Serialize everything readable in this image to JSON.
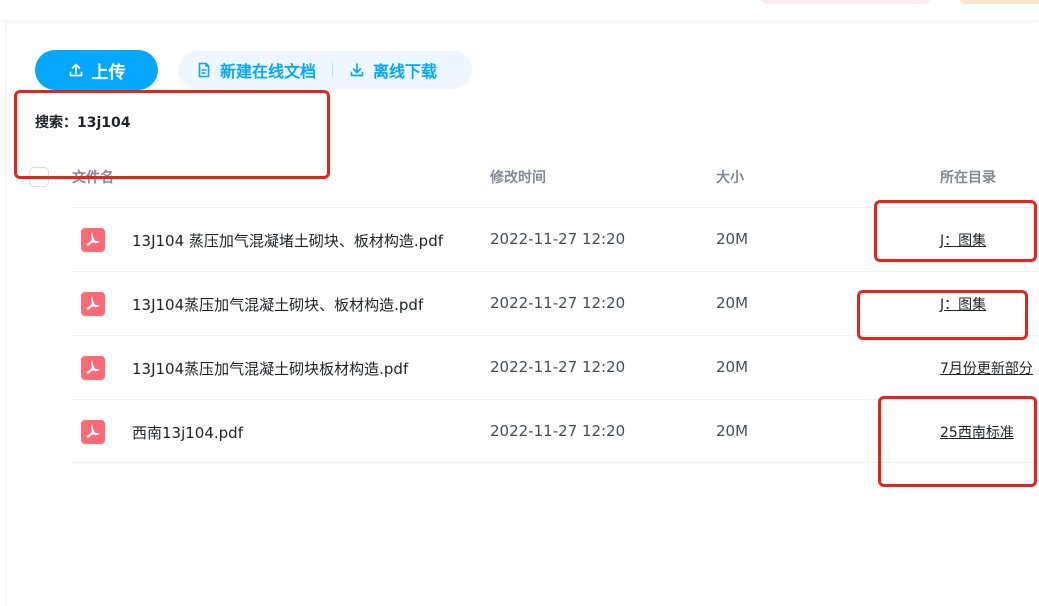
{
  "toolbar": {
    "upload_label": "上传",
    "new_doc_label": "新建在线文档",
    "offline_download_label": "离线下载"
  },
  "search": {
    "label": "搜索：13j104"
  },
  "table": {
    "columns": {
      "name": "文件名",
      "modified": "修改时间",
      "size": "大小",
      "directory": "所在目录"
    },
    "rows": [
      {
        "name": "13J104 蒸压加气混凝堵土砌块、板材构造.pdf",
        "modified": "2022-11-27 12:20",
        "size": "20M",
        "directory": "J：图集",
        "icon": "pdf-icon"
      },
      {
        "name": "13J104蒸压加气混凝土砌块、板材构造.pdf",
        "modified": "2022-11-27 12:20",
        "size": "20M",
        "directory": "J：图集",
        "icon": "pdf-icon"
      },
      {
        "name": "13J104蒸压加气混凝土砌块板材构造.pdf",
        "modified": "2022-11-27 12:20",
        "size": "20M",
        "directory": "7月份更新部分",
        "icon": "pdf-icon"
      },
      {
        "name": "西南13j104.pdf",
        "modified": "2022-11-27 12:20",
        "size": "20M",
        "directory": "25西南标准",
        "icon": "pdf-icon"
      }
    ]
  },
  "colors": {
    "accent": "#06a7ff",
    "pdf": "#ff6a74",
    "annotation": "#e8231c"
  }
}
